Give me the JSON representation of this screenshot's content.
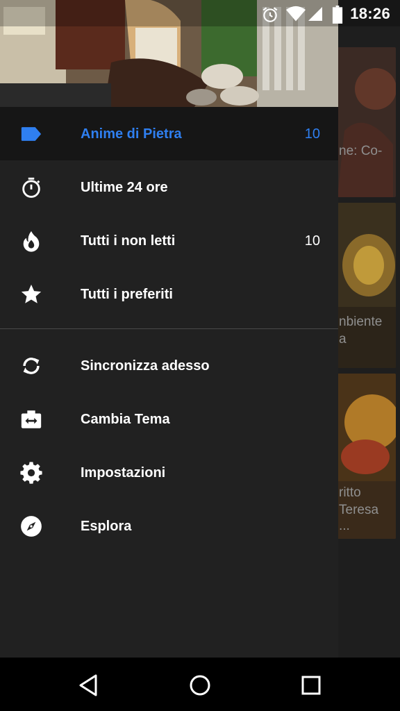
{
  "status_bar": {
    "time": "18:26",
    "icons": [
      "alarm-icon",
      "wifi-icon",
      "signal-icon",
      "battery-icon"
    ]
  },
  "drawer": {
    "items": [
      {
        "label": "Anime di Pietra",
        "count": "10",
        "icon": "label-tag-icon",
        "active": true
      },
      {
        "label": "Ultime 24 ore",
        "count": "",
        "icon": "timer-icon"
      },
      {
        "label": "Tutti i non letti",
        "count": "10",
        "icon": "flame-icon"
      },
      {
        "label": "Tutti i preferiti",
        "count": "",
        "icon": "star-icon"
      }
    ],
    "actions": [
      {
        "label": "Sincronizza adesso",
        "icon": "sync-icon"
      },
      {
        "label": "Cambia Tema",
        "icon": "theme-switch-icon"
      },
      {
        "label": "Impostazioni",
        "icon": "gear-icon"
      },
      {
        "label": "Esplora",
        "icon": "compass-icon"
      }
    ]
  },
  "background_feed": {
    "snippets": [
      "ne: Co-",
      "nbiente",
      "a",
      "ritto",
      "Teresa",
      "..."
    ]
  },
  "nav_bar": {
    "buttons": [
      "back-icon",
      "home-icon",
      "recents-icon"
    ]
  },
  "colors": {
    "accent": "#2f7ff0",
    "drawer_bg": "#212121",
    "active_bg": "#161616"
  }
}
